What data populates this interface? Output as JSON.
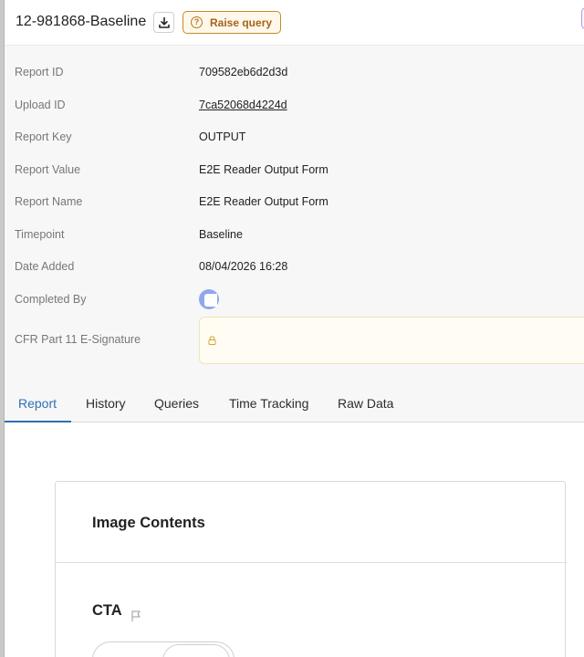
{
  "header": {
    "title": "12-981868-Baseline",
    "raise_query_label": "Raise query",
    "raise_query_icon": "question-circle-icon",
    "download_icon": "download-icon"
  },
  "details": [
    {
      "label": "Report ID",
      "value": "709582eb6d2d3d"
    },
    {
      "label": "Upload ID",
      "value": "7ca52068d4224d"
    },
    {
      "label": "Report Key",
      "value": "OUTPUT"
    },
    {
      "label": "Report Value",
      "value": "E2E Reader Output Form"
    },
    {
      "label": "Report Name",
      "value": "E2E Reader Output Form"
    },
    {
      "label": "Timepoint",
      "value": "Baseline"
    },
    {
      "label": "Date Added",
      "value": "08/04/2026 16:28"
    },
    {
      "label": "Completed By",
      "value": ""
    },
    {
      "label": "CFR Part 11 E-Signature",
      "value": ""
    }
  ],
  "tabs": [
    {
      "label": "Report",
      "active": true
    },
    {
      "label": "History",
      "active": false
    },
    {
      "label": "Queries",
      "active": false
    },
    {
      "label": "Time Tracking",
      "active": false
    },
    {
      "label": "Raw Data",
      "active": false
    }
  ],
  "content": {
    "card_title": "Image Contents",
    "section_label": "CTA",
    "flag_icon": "flag-icon"
  },
  "colors": {
    "accent": "#2f6fb5",
    "raise_query": "#a4641c",
    "avatar": "#8ea8ea",
    "esignature_bg": "#fffdf3"
  }
}
